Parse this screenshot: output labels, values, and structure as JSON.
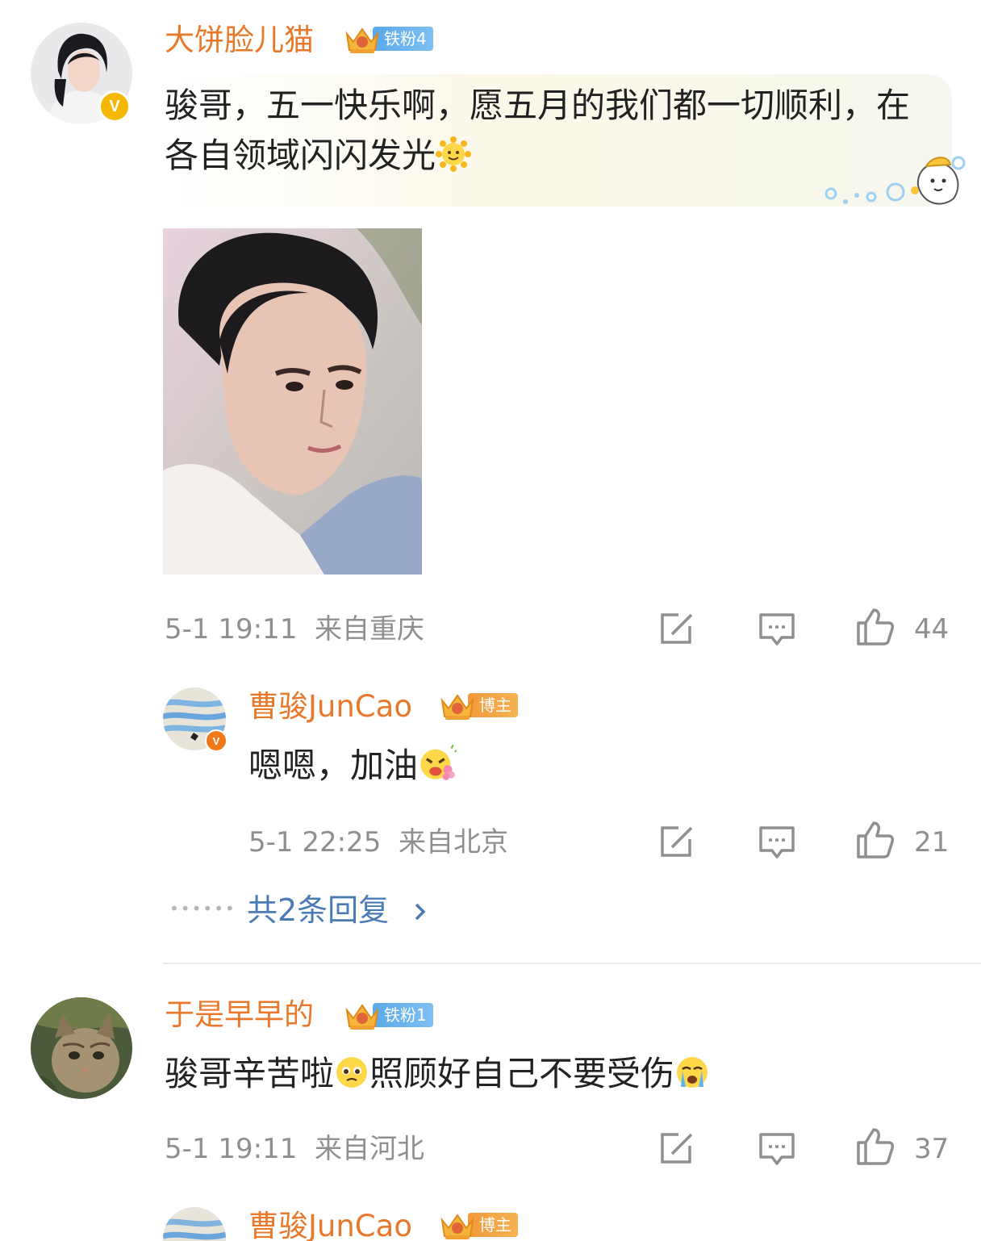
{
  "comments": [
    {
      "user": "大饼脸儿猫",
      "fan_badge": "铁粉4",
      "text": "骏哥，五一快乐啊，愿五月的我们都一切顺利，在各自领域闪闪发光",
      "time": "5-1 19:11",
      "location": "来自重庆",
      "likes": "44",
      "reply": {
        "user": "曹骏JunCao",
        "badge": "博主",
        "text": "嗯嗯，加油",
        "time": "5-1 22:25",
        "location": "来自北京",
        "likes": "21"
      },
      "more_replies": "共2条回复"
    },
    {
      "user": "于是早早的",
      "fan_badge": "铁粉1",
      "text": "骏哥辛苦啦照顾好自己不要受伤",
      "text_part1": "骏哥辛苦啦",
      "text_part2": "照顾好自己不要受伤",
      "time": "5-1 19:11",
      "location": "来自河北",
      "likes": "37",
      "reply_preview": {
        "user": "曹骏JunCao",
        "badge": "博主"
      }
    }
  ],
  "colors": {
    "username": "#e8782a",
    "link": "#4a7bb5",
    "meta": "#8f8f8f",
    "verified_yellow": "#f5b800",
    "verified_orange": "#f07a1a"
  },
  "icons": [
    "repost-icon",
    "comment-icon",
    "like-icon",
    "crown-icon",
    "verified-icon"
  ]
}
